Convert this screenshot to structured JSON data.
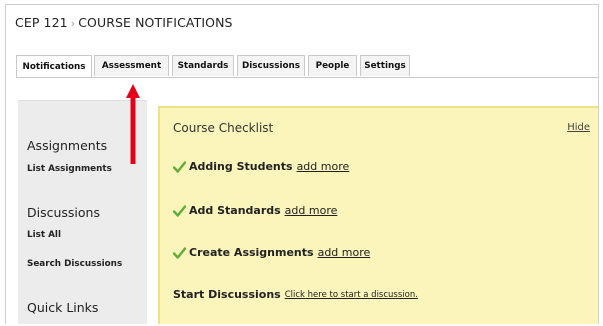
{
  "breadcrumb": {
    "course": "CEP 121",
    "separator": "›",
    "page": "COURSE NOTIFICATIONS"
  },
  "tabs": [
    {
      "label": "Notifications",
      "active": true
    },
    {
      "label": "Assessment",
      "active": false
    },
    {
      "label": "Standards",
      "active": false
    },
    {
      "label": "Discussions",
      "active": false
    },
    {
      "label": "People",
      "active": false
    },
    {
      "label": "Settings",
      "active": false
    }
  ],
  "sidebar": {
    "assignments_heading": "Assignments",
    "list_assignments": "List Assignments",
    "discussions_heading": "Discussions",
    "list_all": "List All",
    "search_discussions": "Search Discussions",
    "quick_links_heading": "Quick Links"
  },
  "checklist": {
    "title": "Course Checklist",
    "hide_label": "Hide",
    "items": [
      {
        "label": "Adding Students",
        "link": "add more",
        "done": true
      },
      {
        "label": "Add Standards",
        "link": "add more",
        "done": true
      },
      {
        "label": "Create Assignments",
        "link": "add more",
        "done": true
      },
      {
        "label": "Start Discussions",
        "link": "Click here to start a discussion.",
        "done": false
      }
    ]
  },
  "colors": {
    "checklist_bg": "#fbf4bb",
    "checklist_border": "#efe08a",
    "check_green": "#5fae3a",
    "arrow_red": "#e3001b",
    "sidebar_bg": "#ececec"
  }
}
